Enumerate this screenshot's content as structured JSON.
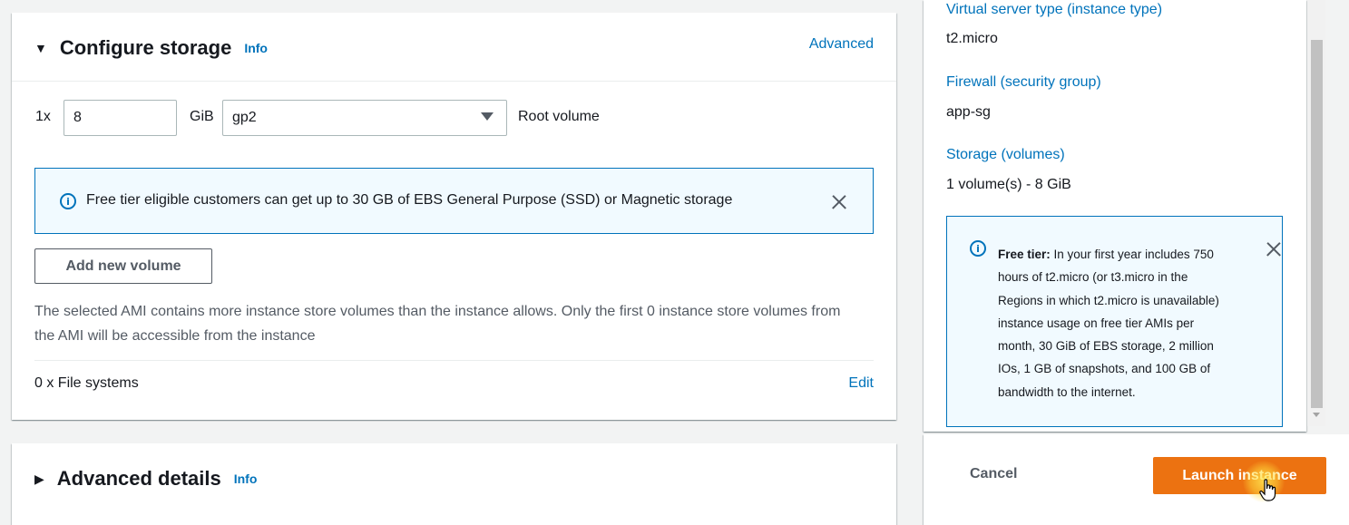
{
  "storage": {
    "title": "Configure storage",
    "info": "Info",
    "advanced_link": "Advanced",
    "volume_count": "1x",
    "size_value": "8",
    "size_unit": "GiB",
    "volume_type": "gp2",
    "volume_label": "Root volume",
    "alert_text": "Free tier eligible customers can get up to 30 GB of EBS General Purpose (SSD) or Magnetic storage",
    "add_volume_button": "Add new volume",
    "ami_note": "The selected AMI contains more instance store volumes than the instance allows. Only the first 0 instance store volumes from the AMI will be accessible from the instance",
    "file_systems": "0 x File systems",
    "edit_link": "Edit"
  },
  "advanced": {
    "title": "Advanced details",
    "info": "Info"
  },
  "summary": {
    "instance_type_label": "Virtual server type (instance type)",
    "instance_type_value": "t2.micro",
    "firewall_label": "Firewall (security group)",
    "firewall_value": "app-sg",
    "storage_label": "Storage (volumes)",
    "storage_value": "1 volume(s) - 8 GiB",
    "free_tier_bold": "Free tier:",
    "free_tier_text": " In your first year includes 750 hours of t2.micro (or t3.micro in the Regions in which t2.micro is unavailable) instance usage on free tier AMIs per month, 30 GiB of EBS storage, 2 million IOs, 1 GB of snapshots, and 100 GB of bandwidth to the internet."
  },
  "actions": {
    "cancel": "Cancel",
    "launch": "Launch instance"
  },
  "colors": {
    "link": "#0073bb",
    "primary": "#ec7211",
    "alert_bg": "#f1faff"
  }
}
